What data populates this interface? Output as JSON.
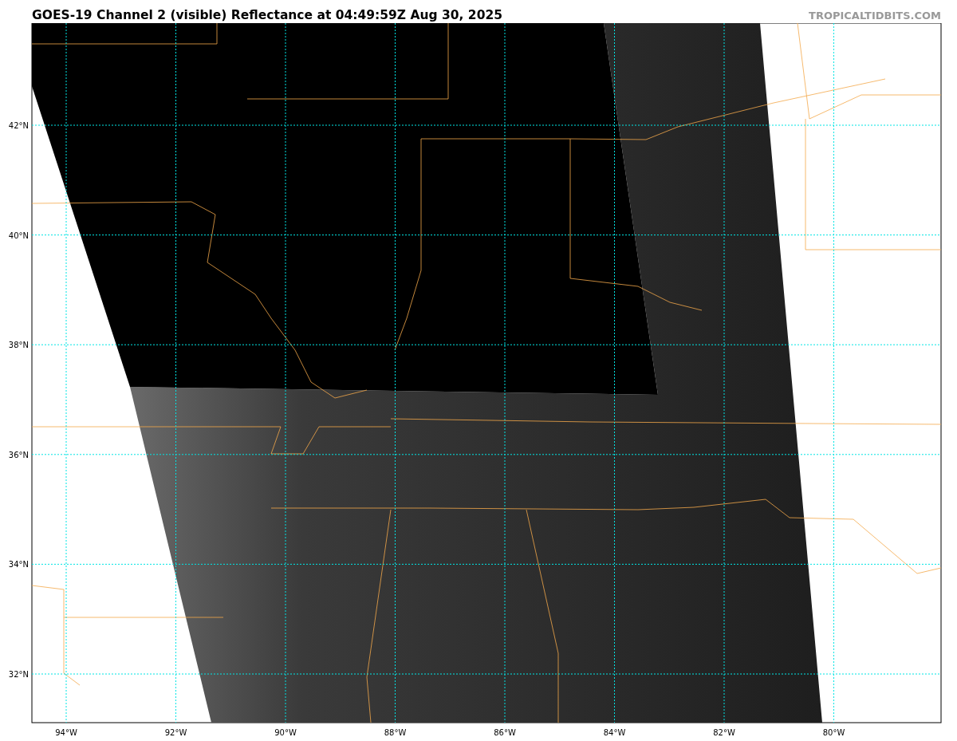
{
  "title": "GOES-19 Channel 2 (visible) Reflectance at 04:49:59Z Aug 30, 2025",
  "credit": "TROPICALTIDBITS.COM",
  "lat_labels": [
    "42°N",
    "40°N",
    "38°N",
    "36°N",
    "34°N",
    "32°N"
  ],
  "lon_labels": [
    "94°W",
    "92°W",
    "90°W",
    "88°W",
    "86°W",
    "84°W",
    "82°W",
    "80°W"
  ]
}
